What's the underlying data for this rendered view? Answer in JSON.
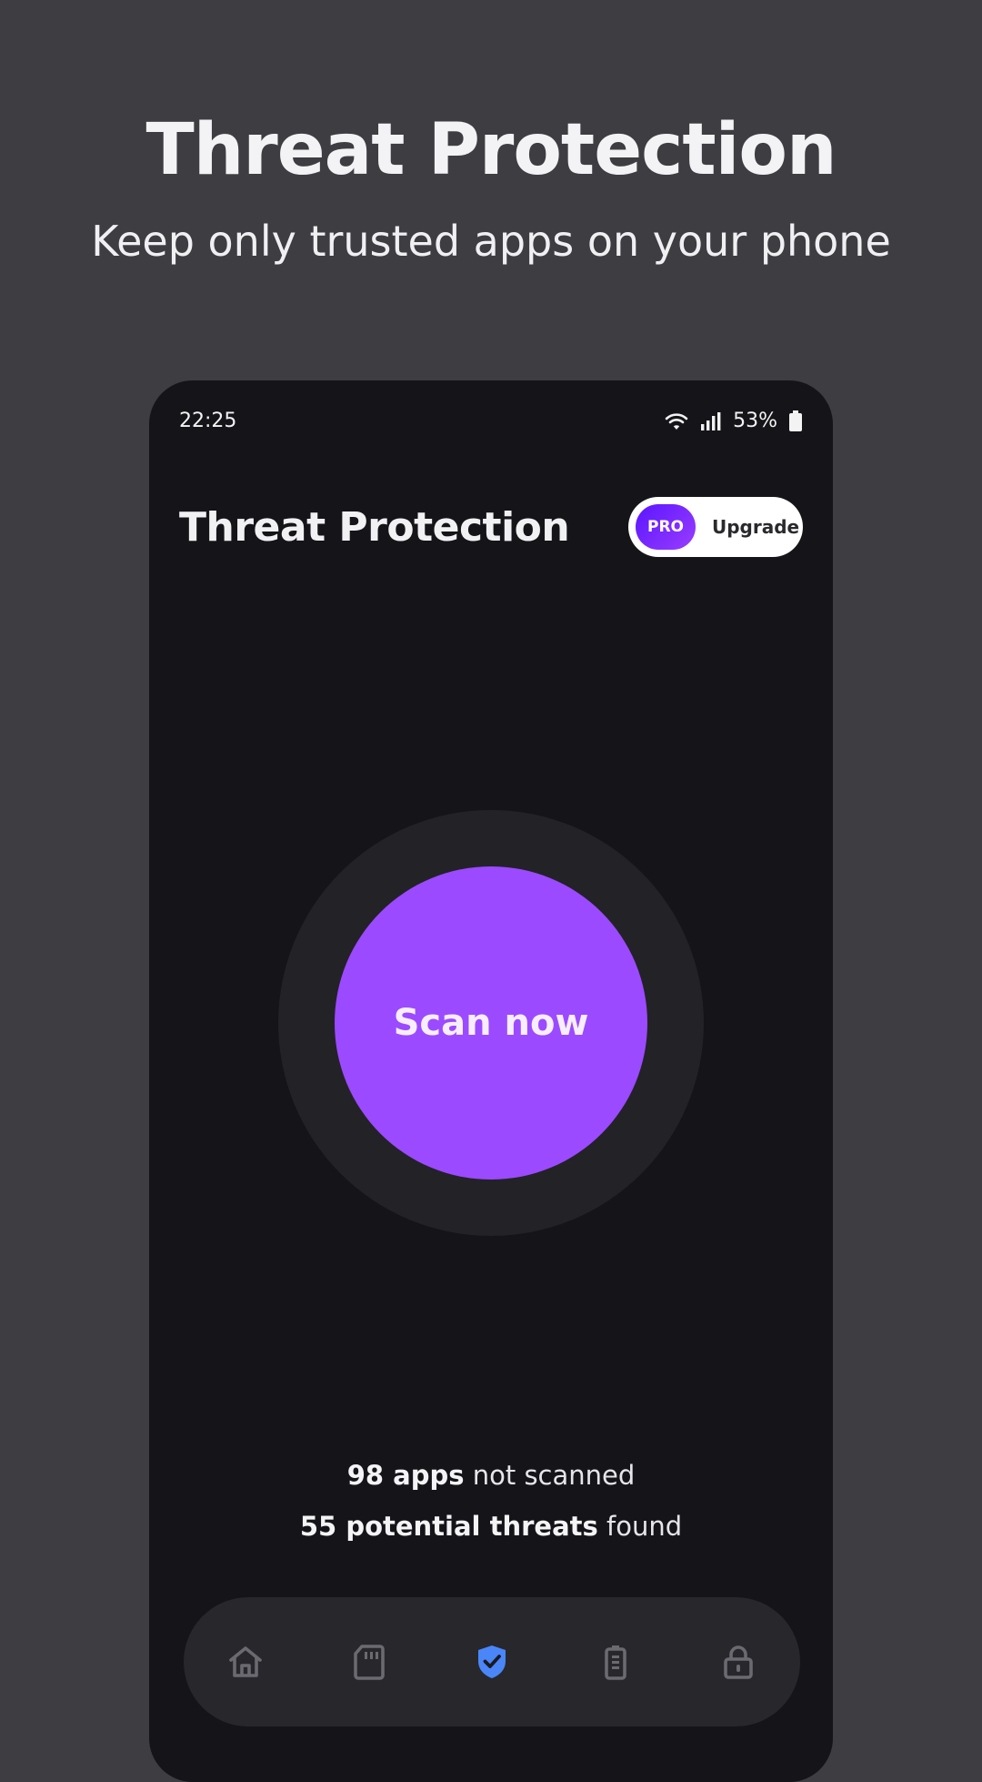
{
  "promo": {
    "title": "Threat Protection",
    "subtitle": "Keep only trusted apps on your phone"
  },
  "status_bar": {
    "time": "22:25",
    "battery": "53%",
    "icons": [
      "wifi-icon",
      "signal-icon",
      "battery-icon"
    ]
  },
  "header": {
    "title": "Threat Protection",
    "pro_badge": "PRO",
    "upgrade_label": "Upgrade"
  },
  "scan": {
    "label": "Scan now"
  },
  "stats": {
    "apps_count": "98 apps",
    "apps_suffix": " not scanned",
    "threats_count": "55 potential threats",
    "threats_suffix": " found"
  },
  "bottom_nav": {
    "items": [
      {
        "icon": "home-icon",
        "active": false
      },
      {
        "icon": "sd-card-icon",
        "active": false
      },
      {
        "icon": "shield-check-icon",
        "active": true
      },
      {
        "icon": "battery-icon",
        "active": false
      },
      {
        "icon": "lock-icon",
        "active": false
      }
    ]
  },
  "colors": {
    "background": "#3e3d42",
    "phone": "#151419",
    "accent": "#9c4aff",
    "active_nav": "#4a86f7",
    "inactive_nav": "#6a6a70"
  }
}
